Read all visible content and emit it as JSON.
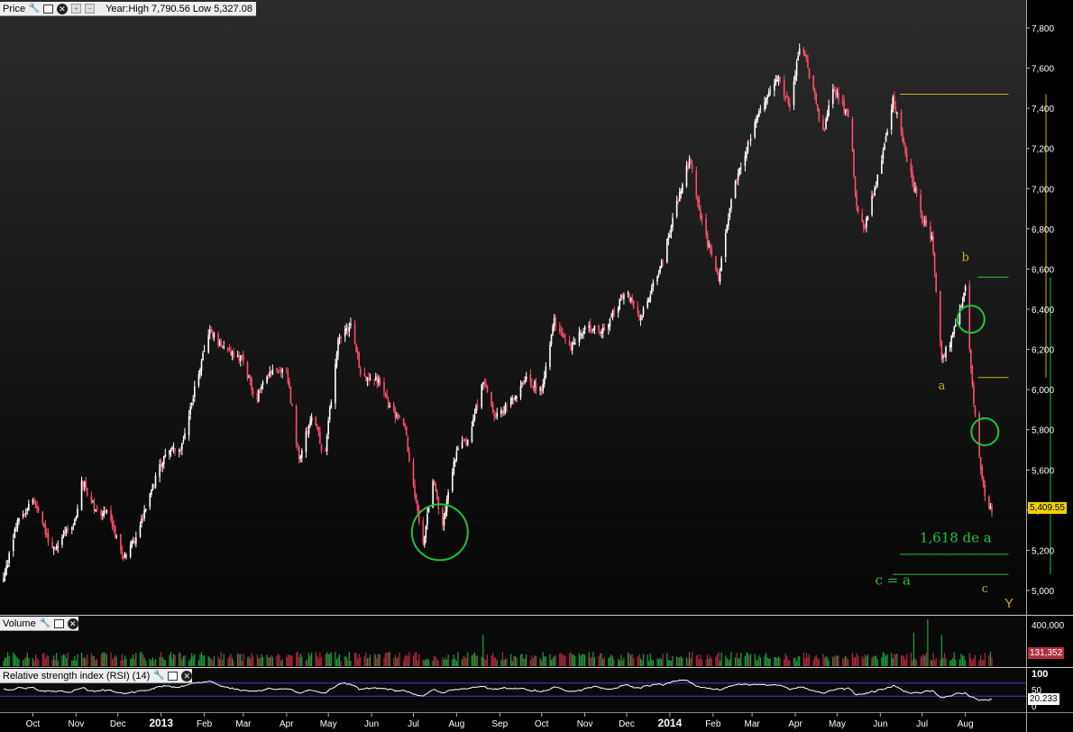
{
  "panels": {
    "price": {
      "label": "Price",
      "info": "Year:High 7,790.56 Low 5,327.08"
    },
    "volume": {
      "label": "Volume"
    },
    "rsi": {
      "label": "Relative strength index (RSI) (14)"
    }
  },
  "current": {
    "price": "5,409.55",
    "volume": "131,352",
    "rsi": "20.233"
  },
  "colors": {
    "background": "#000000",
    "up": "#ffffff",
    "down": "#ff4d6d",
    "annotation_green": "#22c33a",
    "fib_yellow": "#c8b400",
    "rsi": "#ffffff"
  },
  "chart_data": [
    {
      "type": "candlestick",
      "ylim": [
        5000,
        7850
      ],
      "y_ticks": [
        5000,
        5200,
        5400,
        5600,
        5800,
        6000,
        6200,
        6400,
        6600,
        6800,
        7000,
        7200,
        7400,
        7600,
        7800
      ],
      "y_tick_labels": [
        "5,000",
        "5,200",
        "5,400",
        "5,600",
        "5,800",
        "6,000",
        "6,200",
        "6,400",
        "6,600",
        "6,800",
        "7,000",
        "7,200",
        "7,400",
        "7,600",
        "7,800"
      ],
      "x_range": [
        "2012-09-10",
        "2014-08-20"
      ],
      "x_ticks": [
        {
          "date": "2012-10-01",
          "label": "Oct",
          "bold": false
        },
        {
          "date": "2012-11-01",
          "label": "Nov",
          "bold": false
        },
        {
          "date": "2012-12-01",
          "label": "Dec",
          "bold": false
        },
        {
          "date": "2013-01-01",
          "label": "2013",
          "bold": true
        },
        {
          "date": "2013-02-01",
          "label": "Feb",
          "bold": false
        },
        {
          "date": "2013-03-01",
          "label": "Mar",
          "bold": false
        },
        {
          "date": "2013-04-01",
          "label": "Apr",
          "bold": false
        },
        {
          "date": "2013-05-01",
          "label": "May",
          "bold": false
        },
        {
          "date": "2013-06-01",
          "label": "Jun",
          "bold": false
        },
        {
          "date": "2013-07-01",
          "label": "Jul",
          "bold": false
        },
        {
          "date": "2013-08-01",
          "label": "Aug",
          "bold": false
        },
        {
          "date": "2013-09-01",
          "label": "Sep",
          "bold": false
        },
        {
          "date": "2013-10-01",
          "label": "Oct",
          "bold": false
        },
        {
          "date": "2013-11-01",
          "label": "Nov",
          "bold": false
        },
        {
          "date": "2013-12-01",
          "label": "Dec",
          "bold": false
        },
        {
          "date": "2014-01-01",
          "label": "2014",
          "bold": true
        },
        {
          "date": "2014-02-01",
          "label": "Feb",
          "bold": false
        },
        {
          "date": "2014-03-01",
          "label": "Mar",
          "bold": false
        },
        {
          "date": "2014-04-01",
          "label": "Apr",
          "bold": false
        },
        {
          "date": "2014-05-01",
          "label": "May",
          "bold": false
        },
        {
          "date": "2014-06-01",
          "label": "Jun",
          "bold": false
        },
        {
          "date": "2014-07-01",
          "label": "Jul",
          "bold": false
        },
        {
          "date": "2014-08-01",
          "label": "Aug",
          "bold": false
        }
      ],
      "series": [
        {
          "anchors": [
            [
              "2012-09-10",
              5050
            ],
            [
              "2012-09-20",
              5350
            ],
            [
              "2012-10-01",
              5450
            ],
            [
              "2012-10-15",
              5200
            ],
            [
              "2012-11-01",
              5350
            ],
            [
              "2012-11-05",
              5550
            ],
            [
              "2012-11-15",
              5400
            ],
            [
              "2012-11-25",
              5380
            ],
            [
              "2012-12-05",
              5150
            ],
            [
              "2012-12-15",
              5280
            ],
            [
              "2012-12-25",
              5500
            ],
            [
              "2013-01-05",
              5700
            ],
            [
              "2013-01-15",
              5700
            ],
            [
              "2013-01-25",
              6000
            ],
            [
              "2013-02-05",
              6300
            ],
            [
              "2013-02-15",
              6200
            ],
            [
              "2013-02-28",
              6150
            ],
            [
              "2013-03-10",
              5950
            ],
            [
              "2013-03-20",
              6100
            ],
            [
              "2013-04-01",
              6100
            ],
            [
              "2013-04-10",
              5650
            ],
            [
              "2013-04-20",
              5900
            ],
            [
              "2013-04-28",
              5650
            ],
            [
              "2013-05-08",
              6250
            ],
            [
              "2013-05-18",
              6320
            ],
            [
              "2013-05-25",
              6050
            ],
            [
              "2013-06-05",
              6050
            ],
            [
              "2013-06-15",
              5900
            ],
            [
              "2013-06-25",
              5800
            ],
            [
              "2013-07-05",
              5350
            ],
            [
              "2013-07-08",
              5230
            ],
            [
              "2013-07-15",
              5550
            ],
            [
              "2013-07-22",
              5330
            ],
            [
              "2013-08-01",
              5700
            ],
            [
              "2013-08-10",
              5750
            ],
            [
              "2013-08-20",
              6050
            ],
            [
              "2013-08-28",
              5850
            ],
            [
              "2013-09-10",
              5950
            ],
            [
              "2013-09-20",
              6050
            ],
            [
              "2013-10-01",
              6000
            ],
            [
              "2013-10-10",
              6350
            ],
            [
              "2013-10-20",
              6200
            ],
            [
              "2013-11-01",
              6300
            ],
            [
              "2013-11-15",
              6300
            ],
            [
              "2013-12-01",
              6500
            ],
            [
              "2013-12-10",
              6350
            ],
            [
              "2013-12-25",
              6600
            ],
            [
              "2014-01-05",
              6900
            ],
            [
              "2014-01-15",
              7150
            ],
            [
              "2014-01-25",
              6800
            ],
            [
              "2014-02-05",
              6550
            ],
            [
              "2014-02-15",
              7000
            ],
            [
              "2014-02-25",
              7200
            ],
            [
              "2014-03-10",
              7450
            ],
            [
              "2014-03-20",
              7550
            ],
            [
              "2014-03-28",
              7400
            ],
            [
              "2014-04-05",
              7750
            ],
            [
              "2014-04-15",
              7450
            ],
            [
              "2014-04-20",
              7250
            ],
            [
              "2014-04-28",
              7500
            ],
            [
              "2014-05-10",
              7350
            ],
            [
              "2014-05-15",
              6900
            ],
            [
              "2014-05-20",
              6800
            ],
            [
              "2014-06-01",
              7100
            ],
            [
              "2014-06-10",
              7450
            ],
            [
              "2014-06-20",
              7150
            ],
            [
              "2014-07-01",
              6850
            ],
            [
              "2014-07-08",
              6750
            ],
            [
              "2014-07-15",
              6150
            ],
            [
              "2014-07-22",
              6250
            ],
            [
              "2014-08-01",
              6500
            ],
            [
              "2014-08-05",
              6100
            ],
            [
              "2014-08-10",
              5700
            ],
            [
              "2014-08-15",
              5450
            ],
            [
              "2014-08-20",
              5400
            ]
          ]
        }
      ]
    },
    {
      "type": "bar",
      "ylim": [
        0,
        450000
      ],
      "y_ticks": [
        400000
      ],
      "y_tick_labels": [
        "400,000"
      ],
      "series": [
        {
          "typical": 100000,
          "spikes": [
            [
              "2013-08-20",
              300000
            ],
            [
              "2014-06-25",
              320000
            ],
            [
              "2014-07-05",
              450000
            ],
            [
              "2014-07-15",
              300000
            ]
          ]
        }
      ]
    },
    {
      "type": "line",
      "ylim": [
        0,
        100
      ],
      "y_ticks": [
        0,
        50,
        100
      ],
      "y_tick_labels": [
        "0",
        "50",
        "100"
      ],
      "series": [
        {
          "typical": 55
        }
      ]
    }
  ],
  "annotations": {
    "labels": [
      {
        "text": "b",
        "date": "2014-08-01",
        "value": 6640,
        "color": "fib_yellow"
      },
      {
        "text": "a",
        "date": "2014-07-15",
        "value": 6000,
        "color": "fib_yellow"
      },
      {
        "text": "1,618 de a",
        "date": "2014-07-25",
        "value": 5240,
        "color": "annotation_green"
      },
      {
        "text": "c = a",
        "date": "2014-06-10",
        "value": 5030,
        "color": "annotation_green"
      },
      {
        "text": "c",
        "date": "2014-08-15",
        "value": 4990,
        "color": "fib_yellow"
      }
    ],
    "circles": [
      {
        "date": "2013-07-20",
        "value": 5290
      },
      {
        "date": "2014-08-05",
        "value": 6350
      },
      {
        "date": "2014-08-15",
        "value": 5790
      }
    ],
    "levels": [
      {
        "value": 7470,
        "from": "2014-06-15",
        "to": "2014-09-01",
        "color": "fib_yellow"
      },
      {
        "value": 6060,
        "from": "2014-08-10",
        "to": "2014-09-01",
        "color": "fib_yellow"
      },
      {
        "value": 6560,
        "from": "2014-08-10",
        "to": "2014-09-01",
        "color": "annotation_green"
      },
      {
        "value": 5180,
        "from": "2014-06-15",
        "to": "2014-09-01",
        "color": "annotation_green"
      },
      {
        "value": 5080,
        "from": "2014-06-10",
        "to": "2014-09-01",
        "color": "annotation_green"
      }
    ]
  },
  "marker": "Y"
}
